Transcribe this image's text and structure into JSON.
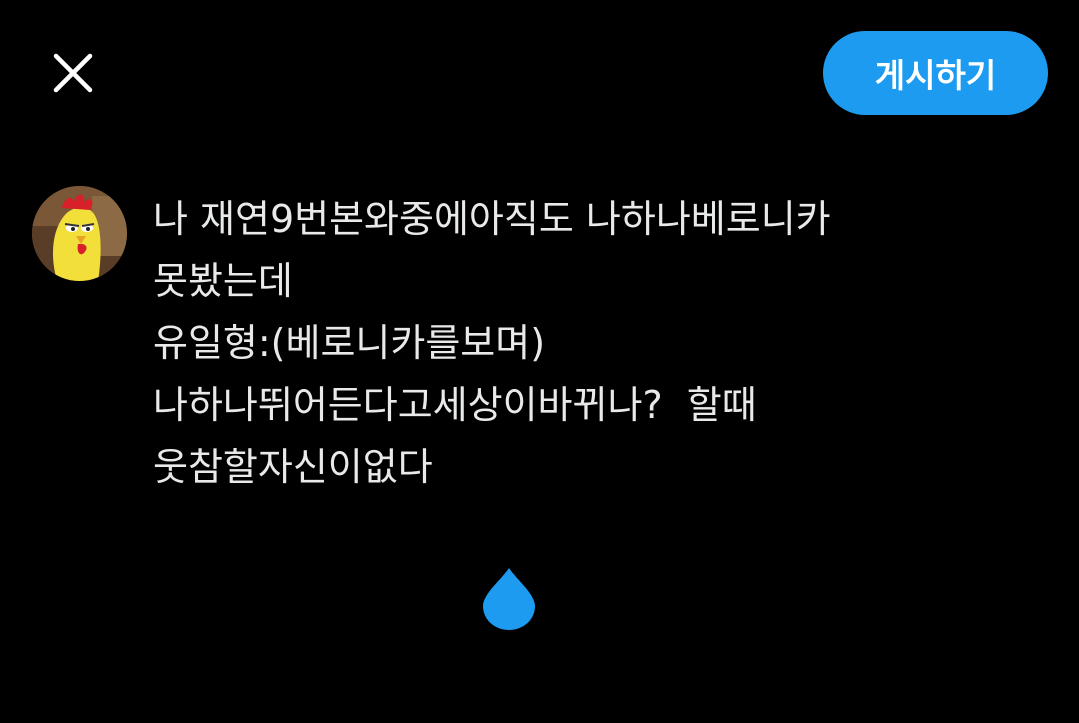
{
  "header": {
    "close_icon": "close-icon",
    "post_button_label": "게시하기"
  },
  "composer": {
    "avatar_icon": "chicken-avatar",
    "text_lines": [
      "나 재연9번본와중에아직도 나하나베로니카",
      "못봤는데",
      "유일형:(베로니카를보며)",
      "나하나뛰어든다고세상이바뀌나?  할때",
      "웃참할자신이없다"
    ],
    "caret_handle_icon": "text-cursor-handle-icon"
  },
  "colors": {
    "background": "#000000",
    "accent": "#1d9bf0",
    "text": "#e7e9ea"
  }
}
